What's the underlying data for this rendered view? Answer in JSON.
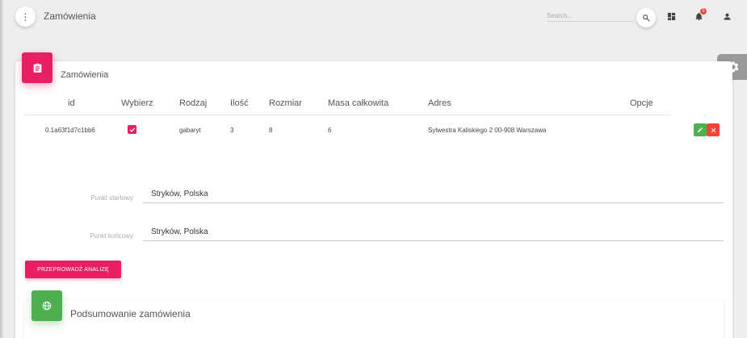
{
  "navbar": {
    "title": "Zamówienia",
    "search_placeholder": "Search...",
    "notification_count": "5",
    "icons": [
      "more-vert-icon",
      "search-icon",
      "dashboard-icon",
      "bell-icon",
      "person-icon"
    ]
  },
  "card": {
    "title": "Zamówienia",
    "icon": "clipboard-icon",
    "accent": "#e91e63"
  },
  "table": {
    "headers": {
      "id": "id",
      "select": "Wybierz",
      "type": "Rodzaj",
      "quantity": "Ilość",
      "size": "Rozmiar",
      "weight": "Masa całkowita",
      "address": "Adres",
      "options": "Opcje"
    },
    "rows": [
      {
        "id": "0.1a63f1d7c1bb6",
        "selected": true,
        "type": "gabaryt",
        "quantity": "3",
        "size": "8",
        "weight": "6",
        "address": "Sylwestra Kaliskiego 2 00-908 Warszawa"
      }
    ]
  },
  "form": {
    "start_label": "Punkt startowy",
    "start_value": "Stryków, Polska",
    "end_label": "Punkt końcowy",
    "end_value": "Stryków, Polska",
    "analyze_button": "PRZEPROWADŹ ANALIZĘ"
  },
  "summary": {
    "title": "Podsumowanie zamówienia",
    "icon": "globe-icon",
    "accent": "#4caf50"
  },
  "colors": {
    "pink": "#e91e63",
    "green": "#4caf50",
    "red": "#f44336",
    "gray_tab": "#999999"
  }
}
